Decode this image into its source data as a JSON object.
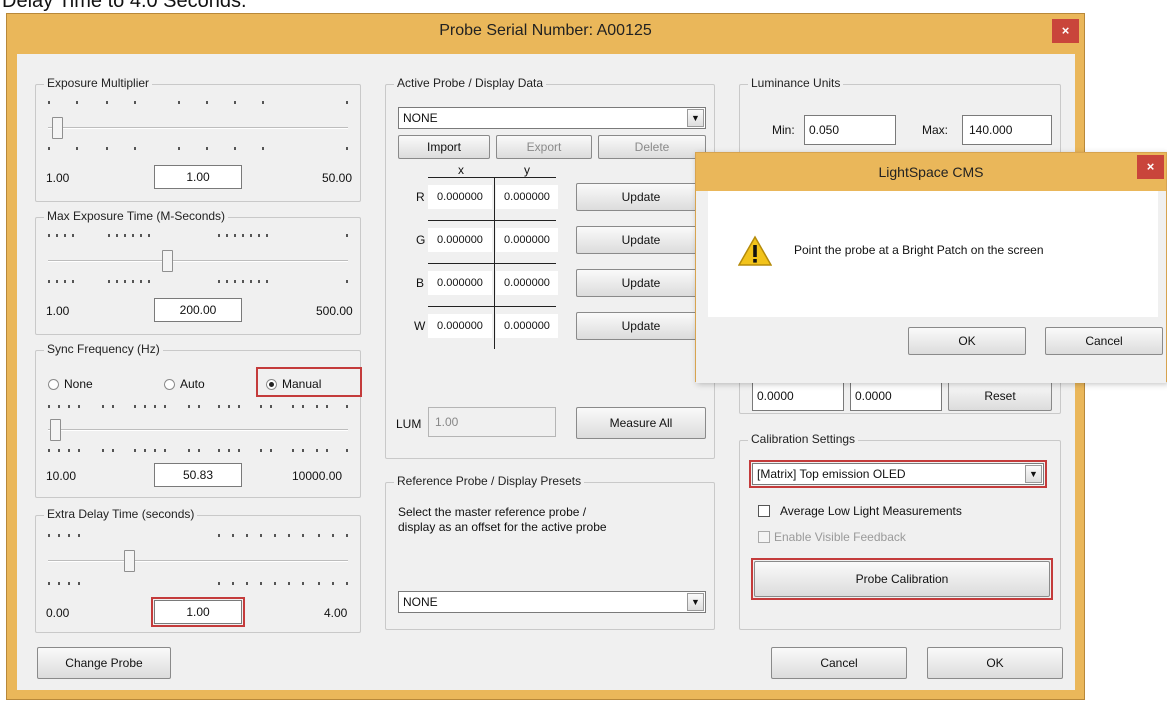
{
  "page_caption": "Delay Time to 4.0 Seconds.",
  "dialog": {
    "title": "Probe Serial Number: A00125",
    "close_glyph": "×",
    "change_probe": "Change Probe",
    "cancel": "Cancel",
    "ok": "OK"
  },
  "exposure": {
    "title": "Exposure Multiplier",
    "min": "1.00",
    "value": "1.00",
    "max": "50.00",
    "level": 0.0
  },
  "max_exposure": {
    "title": "Max Exposure Time (M-Seconds)",
    "min": "1.00",
    "value": "200.00",
    "max": "500.00",
    "level": 0.4
  },
  "sync": {
    "title": "Sync Frequency (Hz)",
    "options": [
      "None",
      "Auto",
      "Manual"
    ],
    "selected": "Manual",
    "min": "10.00",
    "value": "50.83",
    "max": "10000.00",
    "level": 0.004
  },
  "extra_delay": {
    "title": "Extra Delay Time (seconds)",
    "min": "0.00",
    "value": "1.00",
    "max": "4.00",
    "level": 0.25
  },
  "active_probe": {
    "title": "Active Probe / Display Data",
    "combo_value": "NONE",
    "import": "Import",
    "export": "Export",
    "delete": "Delete",
    "col_x": "x",
    "col_y": "y",
    "rows": [
      {
        "label": "R",
        "x": "0.000000",
        "y": "0.000000",
        "button": "Update"
      },
      {
        "label": "G",
        "x": "0.000000",
        "y": "0.000000",
        "button": "Update"
      },
      {
        "label": "B",
        "x": "0.000000",
        "y": "0.000000",
        "button": "Update"
      },
      {
        "label": "W",
        "x": "0.000000",
        "y": "0.000000",
        "button": "Update"
      }
    ],
    "lum_label": "LUM",
    "lum_value": "1.00",
    "measure_all": "Measure All"
  },
  "reference_probe": {
    "title": "Reference Probe / Display Presets",
    "description_line1": "Select the master reference probe /",
    "description_line2": "display as an offset for the active probe",
    "combo_value": "NONE"
  },
  "luminance": {
    "title": "Luminance Units",
    "min_label": "Min:",
    "min_value": "0.050",
    "max_label": "Max:",
    "max_value": "140.000",
    "offset1": "0.0000",
    "offset2": "0.0000",
    "reset": "Reset"
  },
  "calibration": {
    "title": "Calibration Settings",
    "combo_value": "[Matrix] Top emission OLED",
    "average_low_light": "Average Low Light Measurements",
    "enable_visible_feedback": "Enable Visible Feedback",
    "probe_calibration": "Probe Calibration"
  },
  "message_box": {
    "title": "LightSpace CMS",
    "close_glyph": "×",
    "icon": "warning-icon",
    "message": "Point the probe at a Bright Patch on the screen",
    "ok": "OK",
    "cancel": "Cancel"
  },
  "colors": {
    "title_bar": "#eab75a",
    "close_button": "#c9453b",
    "highlight": "#c43b3b",
    "warning": "#f2c31b"
  }
}
